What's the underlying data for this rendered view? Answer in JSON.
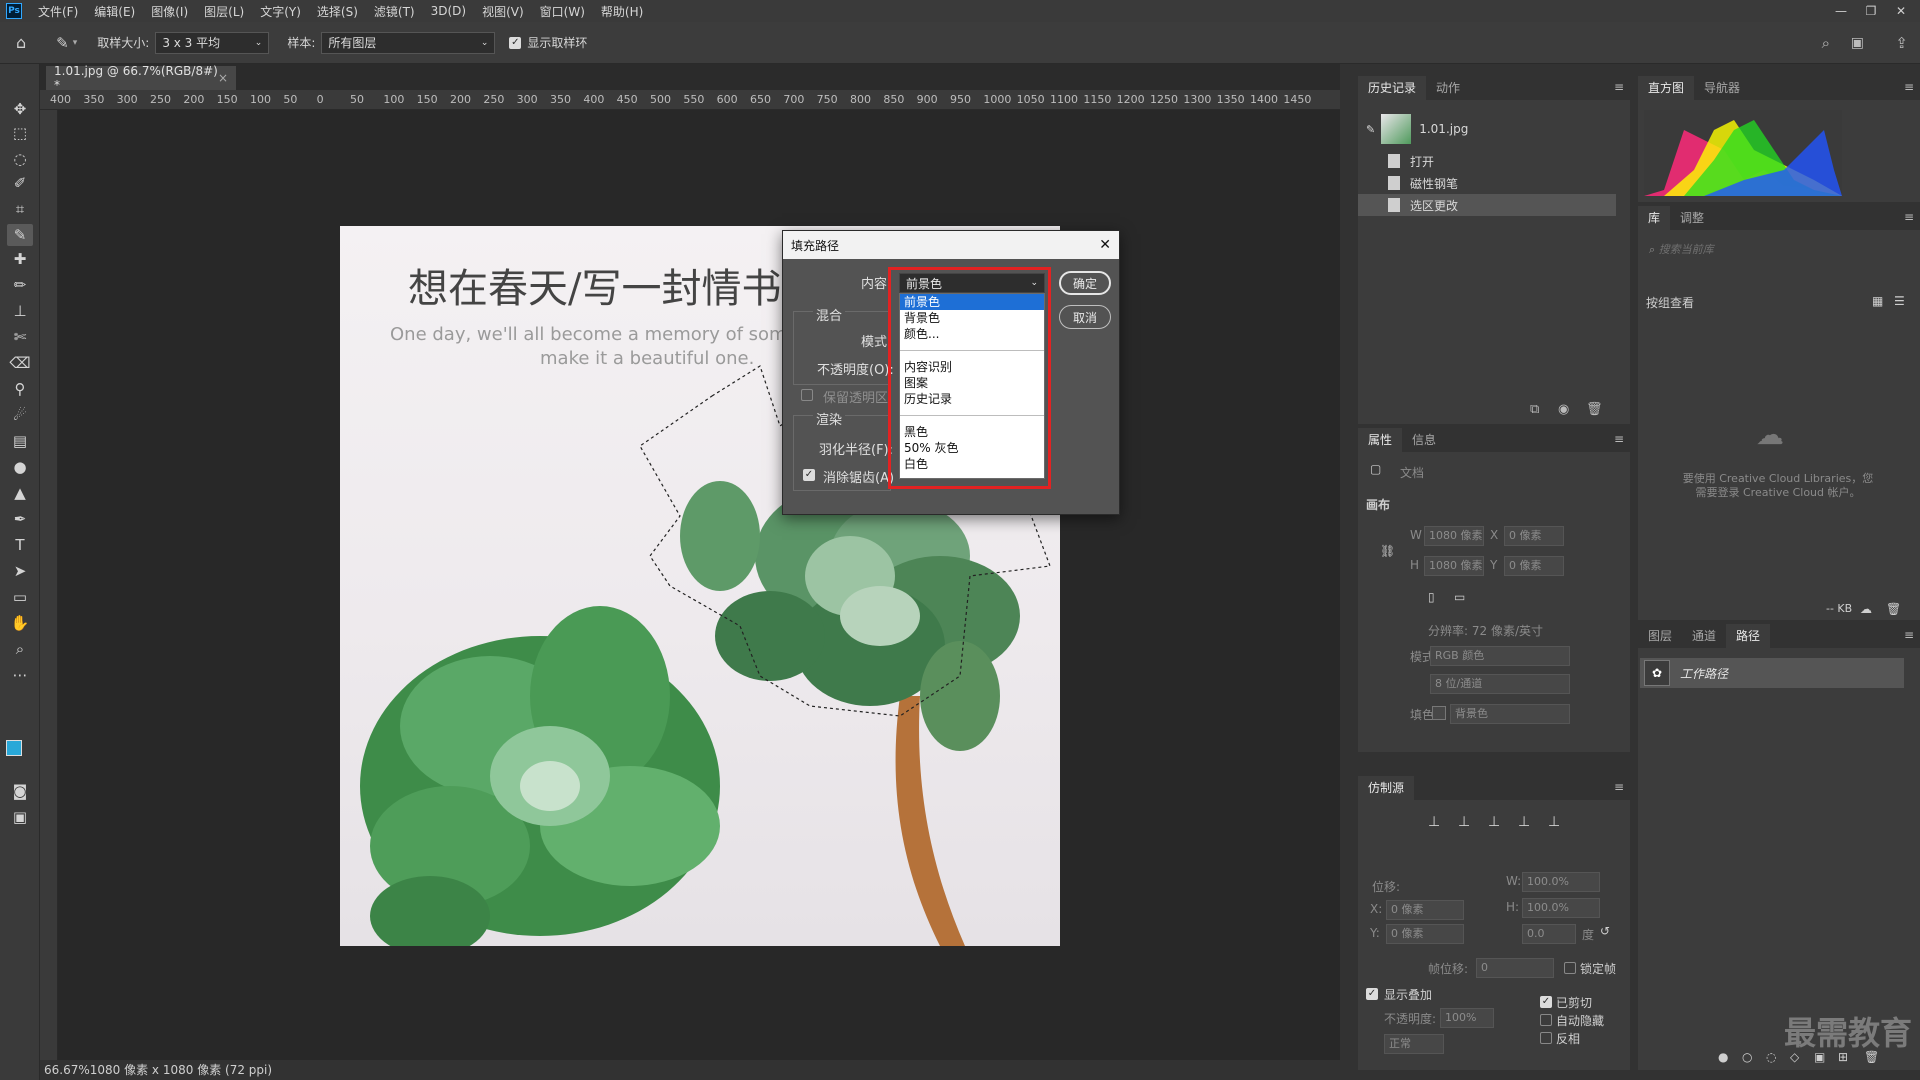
{
  "menubar": {
    "logo": "Ps",
    "items": [
      "文件(F)",
      "编辑(E)",
      "图像(I)",
      "图层(L)",
      "文字(Y)",
      "选择(S)",
      "滤镜(T)",
      "3D(D)",
      "视图(V)",
      "窗口(W)",
      "帮助(H)"
    ],
    "window_controls": [
      "—",
      "❐",
      "✕"
    ]
  },
  "options": {
    "sample_size_label": "取样大小:",
    "sample_size_value": "3 x 3 平均",
    "sample_label": "样本:",
    "sample_value": "所有图层",
    "show_ring_label": "显示取样环",
    "show_ring_checked": true
  },
  "document": {
    "tab_title": "1.01.jpg @ 66.7%(RGB/8#) *",
    "ruler_ticks": [
      "400",
      "350",
      "300",
      "250",
      "200",
      "150",
      "100",
      "50",
      "0",
      "50",
      "100",
      "150",
      "200",
      "250",
      "300",
      "350",
      "400",
      "450",
      "500",
      "550",
      "600",
      "650",
      "700",
      "750",
      "800",
      "850",
      "900",
      "950",
      "1000",
      "1050",
      "1100",
      "1150",
      "1200",
      "1250",
      "1300",
      "1350",
      "1400",
      "1450"
    ],
    "status": "66.67%1080 像素 x 1080 像素 (72 ppi)",
    "image_title": "想在春天/写一封情书",
    "image_sub1": "One day, we'll all become a memory of som",
    "image_sub2": "make it a beautiful one."
  },
  "dialog": {
    "title": "填充路径",
    "content_label": "内容:",
    "content_value": "前景色",
    "ok": "确定",
    "cancel": "取消",
    "blend_label": "混合",
    "mode_label": "模式:",
    "opacity_label": "不透明度(O):",
    "preserve_label": "保留透明区",
    "render_label": "渲染",
    "feather_label": "羽化半径(F):",
    "antialias_label": "消除锯齿(A)",
    "dropdown_group1": [
      "前景色",
      "背景色",
      "颜色..."
    ],
    "dropdown_group2": [
      "内容识别",
      "图案",
      "历史记录"
    ],
    "dropdown_group3": [
      "黑色",
      "50% 灰色",
      "白色"
    ]
  },
  "history_panel": {
    "tabs": [
      "历史记录",
      "动作"
    ],
    "snapshot": "1.01.jpg",
    "items": [
      "打开",
      "磁性钢笔",
      "选区更改"
    ]
  },
  "histogram_panel": {
    "tabs": [
      "直方图",
      "导航器"
    ]
  },
  "library_panel": {
    "tabs": [
      "库",
      "调整"
    ],
    "search_placeholder": "搜索当前库",
    "view_by": "按组查看",
    "message": "要使用 Creative Cloud Libraries，您需要登录 Creative Cloud 帐户。",
    "size": "-- KB"
  },
  "properties_panel": {
    "tabs": [
      "属性",
      "信息"
    ],
    "doc_label": "文档",
    "canvas_label": "画布",
    "w_label": "W",
    "w_value": "1080 像素",
    "x_label": "X",
    "x_value": "0 像素",
    "h_label": "H",
    "h_value": "1080 像素",
    "y_label": "Y",
    "y_value": "0 像素",
    "resolution": "分辨率: 72 像素/英寸",
    "mode_label": "模式",
    "mode_value": "RGB 颜色",
    "depth_value": "8 位/通道",
    "fill_label": "填色",
    "fill_value": "背景色"
  },
  "paths_panel": {
    "tabs": [
      "图层",
      "通道",
      "路径"
    ],
    "work_path": "工作路径"
  },
  "clone_panel": {
    "tab": "仿制源",
    "offset_label": "位移:",
    "x_label": "X:",
    "x_value": "0 像素",
    "y_label": "Y:",
    "y_value": "0 像素",
    "w_label": "W:",
    "w_value": "100.0%",
    "h_label": "H:",
    "h_value": "100.0%",
    "angle_value": "0.0",
    "degree": "度",
    "frame_offset_label": "帧位移:",
    "frame_offset_value": "0",
    "lock_frame_label": "锁定帧",
    "show_overlay_label": "显示叠加",
    "opacity_label": "不透明度:",
    "opacity_value": "100%",
    "mode_value": "正常",
    "clipped_label": "已剪切",
    "auto_hide_label": "自动隐藏",
    "invert_label": "反相"
  },
  "watermark": "最需教育",
  "colors": {
    "accent": "#1e6fd6",
    "highlight": "#e32222",
    "foreground": "#29a8d8"
  }
}
